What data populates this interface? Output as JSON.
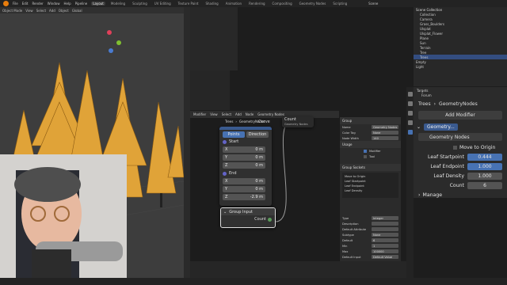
{
  "topbar": {
    "menus": [
      "File",
      "Edit",
      "Render",
      "Window",
      "Help",
      "Pipeline"
    ],
    "workspaces": [
      "Layout",
      "Modeling",
      "Sculpting",
      "UV Editing",
      "Texture Paint",
      "Shading",
      "Animation",
      "Rendering",
      "Compositing",
      "Geometry Nodes",
      "Scripting"
    ],
    "active_workspace": "Layout",
    "scene": "Scene"
  },
  "viewport": {
    "mode": "Object Mode",
    "menus": [
      "View",
      "Select",
      "Add",
      "Object"
    ],
    "transform": "Global",
    "tools": [
      "Select Box",
      "Annotate",
      "Links Cut"
    ]
  },
  "node_editor": {
    "menus": [
      "Modifier",
      "View",
      "Select",
      "Add",
      "Node"
    ],
    "tree_name": "Geometry Nodes",
    "breadcrumb": [
      "Trees",
      "GeometryNodes"
    ],
    "points_node": {
      "tabs": [
        "Points",
        "Direction"
      ],
      "start_label": "Start",
      "start": {
        "x": "0 m",
        "y": "0 m",
        "z": "0 m"
      },
      "end_label": "End",
      "end": {
        "x": "0 m",
        "y": "0 m",
        "z": "-2.9 m"
      },
      "output": "Curve"
    },
    "group_input_node": {
      "title": "Group Input",
      "output": "Count"
    },
    "count_node": {
      "title": "Count",
      "subtitle": "Geometry Nodes"
    }
  },
  "npanel": {
    "group_title": "Group",
    "name_label": "Name",
    "name_value": "Geometry Nodes",
    "color_tag_label": "Color Tag",
    "color_tag_value": "None",
    "node_width_label": "Node Width",
    "node_width_value": "140",
    "usage_title": "Usage",
    "usage_modifier": "Modifier",
    "usage_tool": "Tool",
    "sockets_title": "Group Sockets",
    "sockets": [
      "Move to Origin",
      "Leaf Startpoint",
      "Leaf Endpoint",
      "Leaf Density"
    ],
    "type_label": "Type",
    "type_value": "Integer",
    "description_label": "Description",
    "default_attr_label": "Default Attribute",
    "subtype_label": "Subtype",
    "subtype_value": "None",
    "default_label": "Default",
    "default_value": "6",
    "min_label": "Min",
    "min_value": "1",
    "max_label": "Max",
    "max_value": "100000",
    "default_input_label": "Default Input",
    "default_input_value": "Default Value",
    "hide_value": "Hide Value"
  },
  "outliner": {
    "title": "Scene Collection",
    "items": [
      "Collection",
      "Camera",
      "Grass_Boulders",
      "Ulsplat",
      "Ulsplat_Flower",
      "Plane",
      "Sun",
      "Terrain",
      "Tree",
      "Trees"
    ],
    "selected": "Trees",
    "extra": [
      "Empty",
      "Light"
    ]
  },
  "properties": {
    "targets_label": "Targets",
    "forum_label": "Forum",
    "object_name": "Trees",
    "modifier_tree": "GeometryNodes",
    "add_modifier": "Add Modifier",
    "modifier_name": "Geometry...",
    "node_group": "Geometry Nodes",
    "move_to_origin": "Move to Origin",
    "fields": [
      {
        "label": "Leaf Startpoint",
        "value": "0.444",
        "style": "blue"
      },
      {
        "label": "Leaf Endpoint",
        "value": "1.000",
        "style": "blue"
      },
      {
        "label": "Leaf Density",
        "value": "1.000",
        "style": "plain"
      },
      {
        "label": "Count",
        "value": "6",
        "style": "plain"
      }
    ],
    "manage": "Manage"
  },
  "colors": {
    "accent": "#4772b3",
    "tree_orange": "#e0a338",
    "node_header_blue": "#3a5a8f",
    "group_input_header": "#3c3c3c",
    "vector_socket": "#6363c7",
    "float_socket": "#a1a1a1",
    "geometry_socket": "#00d6a3"
  }
}
